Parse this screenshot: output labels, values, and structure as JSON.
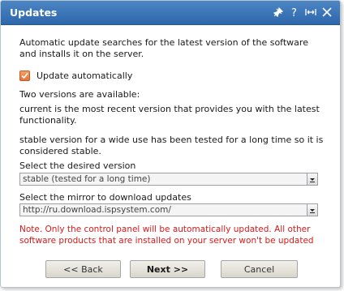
{
  "dialog": {
    "title": "Updates",
    "icons": [
      "pin-icon",
      "help-icon",
      "maximize-icon",
      "close-icon"
    ],
    "help_glyph": "?"
  },
  "content": {
    "intro": "Automatic update searches for the latest version of the software and installs it on the server.",
    "auto_update_label": "Update automatically",
    "auto_update_checked": true,
    "versions_heading": "Two versions are available:",
    "current_desc": "current is the most recent version that provides you with the latest functionality.",
    "stable_desc": "stable version for a wide use has been tested for a long time so it is considered stable.",
    "version_label": "Select the desired version",
    "version_value": "stable (tested for a long time)",
    "mirror_label": "Select the mirror to download updates",
    "mirror_value": "http://ru.download.ispsystem.com/",
    "note": "Note. Only the control panel will be automatically updated. All other software products that are installed on your server won't be updated"
  },
  "buttons": {
    "back": "<< Back",
    "next": "Next >>",
    "cancel": "Cancel"
  },
  "colors": {
    "titlebar": "#2d67ab",
    "note": "#d81a1a",
    "checkbox": "#e0753a"
  }
}
